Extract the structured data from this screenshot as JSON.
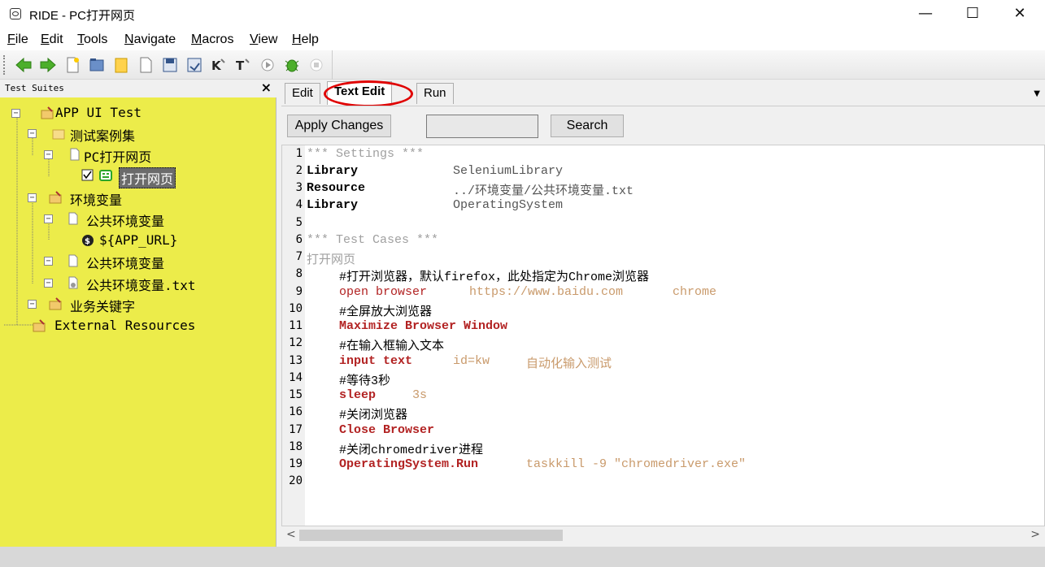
{
  "window": {
    "title": "RIDE - PC打开网页",
    "minimize": "—",
    "maximize": "☐",
    "close": "✕"
  },
  "menu": [
    "File",
    "Edit",
    "Tools",
    "Navigate",
    "Macros",
    "View",
    "Help"
  ],
  "left_panel": {
    "title": "Test Suites",
    "close": "×",
    "tree": {
      "root": "APP UI Test",
      "suite1": "测试案例集",
      "file1": "PC打开网页",
      "testcase": "打开网页",
      "resource1": "环境变量",
      "res_file1": "公共环境变量",
      "variable": "${APP_URL}",
      "res_file2": "公共环境变量",
      "res_file3": "公共环境变量.txt",
      "keywords": "业务关键字",
      "external": "External Resources"
    }
  },
  "tabs": [
    "Edit",
    "Text Edit",
    "Run"
  ],
  "active_tab": "Text Edit",
  "buttons": {
    "apply": "Apply Changes",
    "search": "Search"
  },
  "search_value": "",
  "editor": {
    "line_numbers": [
      "1",
      "2",
      "3",
      "4",
      "5",
      "6",
      "7",
      "8",
      "9",
      "10",
      "11",
      "12",
      "13",
      "14",
      "15",
      "16",
      "17",
      "18",
      "19",
      "20"
    ],
    "l1": "*** Settings ***",
    "l2a": "Library",
    "l2b": "SeleniumLibrary",
    "l3a": "Resource",
    "l3b": "../环境变量/公共环境变量.txt",
    "l4a": "Library",
    "l4b": "OperatingSystem",
    "l6": "*** Test Cases ***",
    "l7": "打开网页",
    "l8": "#打开浏览器，默认firefox，此处指定为Chrome浏览器",
    "l9a": "open browser",
    "l9b": "https://www.baidu.com",
    "l9c": "chrome",
    "l10": "#全屏放大浏览器",
    "l11": "Maximize Browser Window",
    "l12": "#在输入框输入文本",
    "l13a": "input text",
    "l13b": "id=kw",
    "l13c": "自动化输入测试",
    "l14": "#等待3秒",
    "l15a": "sleep",
    "l15b": "3s",
    "l16": "#关闭浏览器",
    "l17": "Close Browser",
    "l18": "#关闭chromedriver进程",
    "l19a": "OperatingSystem.Run",
    "l19b": "taskkill -9 \"chromedriver.exe\""
  },
  "colors": {
    "left_panel_bg": "#ecec4a",
    "keyword": "#b22222",
    "argument": "#c99a6b",
    "highlight_circle": "#e00000"
  }
}
